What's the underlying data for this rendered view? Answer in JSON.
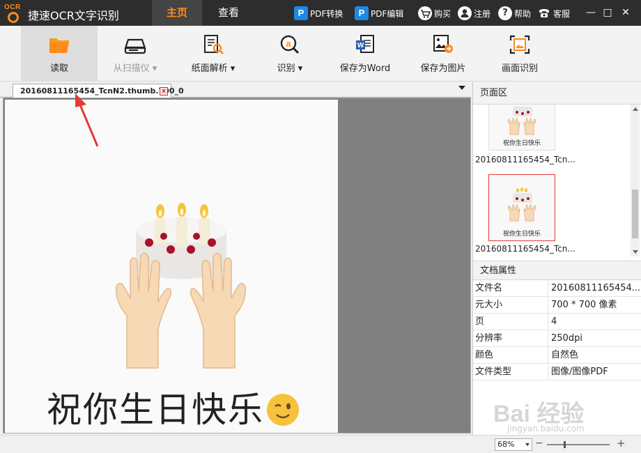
{
  "app": {
    "logo_text": "OCR",
    "title": "捷速OCR文字识别"
  },
  "main_tabs": [
    {
      "label": "主页"
    },
    {
      "label": "查看"
    }
  ],
  "top_links": [
    {
      "label": "PDF转换",
      "icon": "P"
    },
    {
      "label": "PDF编辑",
      "icon": "P"
    },
    {
      "label": "购买",
      "icon": "cart-icon"
    },
    {
      "label": "注册",
      "icon": "user-icon"
    },
    {
      "label": "帮助",
      "icon": "?"
    },
    {
      "label": "客服",
      "icon": "phone-icon"
    }
  ],
  "window_controls": {
    "minimize": "—",
    "maximize": "□",
    "close": "✕"
  },
  "toolbar": {
    "read": "读取",
    "scanner": "从扫描仪 ▾",
    "parse": "纸面解析 ▾",
    "recognize": "识别 ▾",
    "save_word": "保存为Word",
    "save_image": "保存为图片",
    "area_recognize": "画面识别"
  },
  "document_tab": {
    "name": "20160811165454_TcnN2.thumb.700_0",
    "close": "x"
  },
  "page_image": {
    "greeting": "祝你生日快乐"
  },
  "page_panel": {
    "title": "页面区",
    "thumbnails": [
      {
        "caption": "祝你生日快乐",
        "name": "20160811165454_Tcn..."
      },
      {
        "caption": "祝你生日快乐",
        "name": "20160811165454_Tcn..."
      }
    ]
  },
  "properties": {
    "title": "文档属性",
    "rows": [
      {
        "key": "文件名",
        "value": "20160811165454..."
      },
      {
        "key": "元大小",
        "value": "700 * 700 像素"
      },
      {
        "key": "页",
        "value": "4"
      },
      {
        "key": "分辨率",
        "value": "250dpi"
      },
      {
        "key": "颜色",
        "value": "自然色"
      },
      {
        "key": "文件类型",
        "value": "图像/图像PDF"
      }
    ]
  },
  "statusbar": {
    "zoom": "68%",
    "minus": "−",
    "plus": "+"
  },
  "watermark": {
    "text": "Bai 经验",
    "sub": "jingyan.baidu.com"
  },
  "colors": {
    "accent": "#ff8a1c",
    "titlebar": "#2d2d2d",
    "pdf_blue": "#1e88e5",
    "selection_red": "#e53935"
  }
}
